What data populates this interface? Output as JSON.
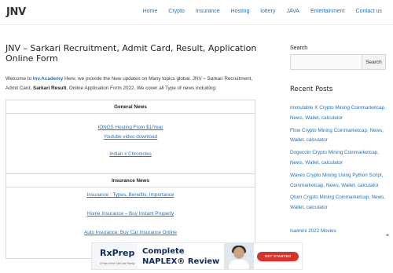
{
  "site": {
    "logo": "JNV",
    "nav": [
      "Home",
      "Crypto",
      "Insurance",
      "Hosting",
      "lottery",
      "JAVA",
      "Entertainment",
      "Contact us"
    ]
  },
  "article": {
    "title": "JNV – Sarkari Recruitment, Admit Card, Result, Application Online Form",
    "intro_prefix": "Welcome to ",
    "intro_link": "Inv.Academy",
    "intro_mid": " Here, we provide the New updates on Many topics global. JNV – Sarkari Recruitment, Admit Card, ",
    "intro_bold": "Sarkari Result",
    "intro_suffix": ", Online Application Form 2022. We cover all Type of news including:",
    "sections": [
      {
        "heading": "General News",
        "links": [
          "IONOS Hosting From $1/Year",
          "Youtube video download",
          "Indian x Chronicles"
        ]
      },
      {
        "heading": "Insurance News",
        "links": [
          "Insurance : Types, Benefits, Importance",
          "Home Insurance – Buy Instant Property",
          "Auto Insurance: Buy Car Insurance Online"
        ]
      }
    ]
  },
  "sidebar": {
    "search_label": "Search",
    "search_value": "",
    "search_button": "Search",
    "recent_title": "Recent Posts",
    "recent_posts": [
      "Immutable X Crypto Mining Coinmarketcap, News, Wallet, calculator",
      "Flow Crypto Mining Coinmarketcap, News, Wallet, calculator",
      "Dogecoin Crypto Mining Coinmarketcap, News, Wallet, calculator",
      "Waves Crypto Mining Using Python Script, Coinmarketcap, News, Wallet, calculator",
      "Qtum Crypto Mining Coinmarketcap, News, Wallet, calculator"
    ],
    "extra_post": "Isaimini 2022 Movies"
  },
  "ad": {
    "logo": "RxPrep",
    "logo_sub": "A Part of the ClinCalc Family",
    "line1": "Complete",
    "line2": "NAPLEX® Review",
    "cta": "GET STARTED"
  },
  "close_glyph": "×",
  "colors": {
    "link": "#1e73be",
    "ad_cta": "#d6332b",
    "ad_text": "#0e2a5a"
  }
}
